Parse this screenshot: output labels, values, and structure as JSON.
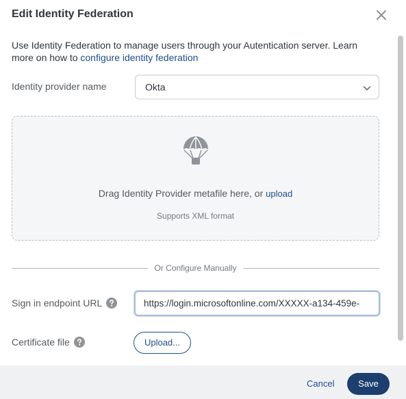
{
  "dialog": {
    "title": "Edit Identity Federation"
  },
  "intro": {
    "text": "Use Identity Federation to manage users through your Autentication server. Learn more on how to ",
    "link_text": "configure identity federation"
  },
  "provider": {
    "label": "Identity provider name",
    "selected": "Okta"
  },
  "dropzone": {
    "text": "Drag Identity Provider metafile here, or ",
    "link_text": "upload",
    "subtext": "Supports XML format"
  },
  "divider": {
    "text": "Or Configure Manually"
  },
  "signin": {
    "label": "Sign in endpoint URL",
    "value": "https://login.microsoftonline.com/XXXXX-a134-459e-"
  },
  "certificate": {
    "label": "Certificate file",
    "button_label": "Upload..."
  },
  "footer": {
    "cancel_label": "Cancel",
    "save_label": "Save"
  },
  "colors": {
    "accent": "#1d4e89",
    "primary_button": "#1d3f6e",
    "footer_bg": "#f0f1f3"
  },
  "icons": {
    "close": "close-icon",
    "chevron": "chevron-down-icon",
    "dropzone": "parachute-icon",
    "help": "help-icon"
  }
}
